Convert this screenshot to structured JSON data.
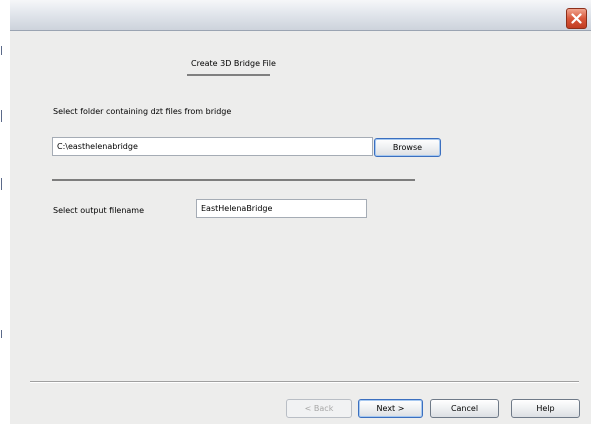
{
  "window": {
    "close_icon": "close-icon",
    "accent_close": "#d8573a"
  },
  "content": {
    "page_title": "Create 3D Bridge File",
    "folder_label": "Select folder containing dzt files from bridge",
    "folder_value": "C:\\easthelenabridge",
    "browse_label": "Browse",
    "output_label": "Select output filename",
    "output_value": "EastHelenaBridge"
  },
  "buttons": {
    "back_label": "< Back",
    "next_label": "Next >",
    "cancel_label": "Cancel",
    "help_label": "Help"
  }
}
